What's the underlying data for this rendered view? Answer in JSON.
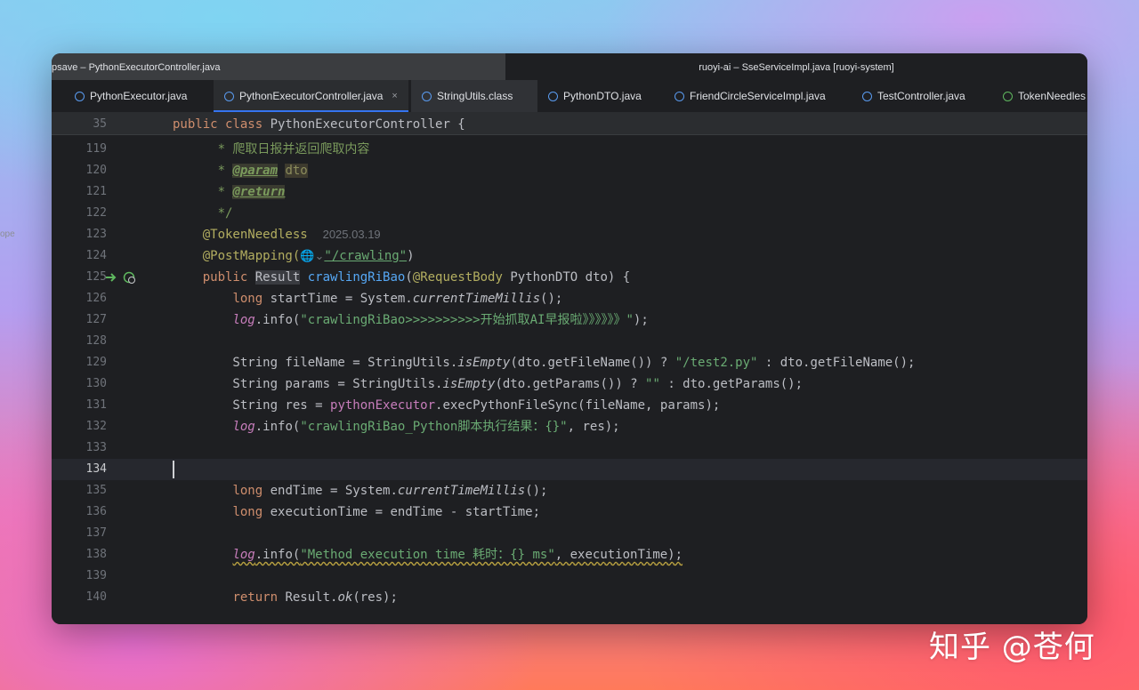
{
  "window": {
    "title_left": "psave – PythonExecutorController.java",
    "title_right": "ruoyi-ai – SseServiceImpl.java [ruoyi-system]"
  },
  "tabs": [
    {
      "label": "PythonExecutor.java",
      "icon": "class-icon",
      "active": false
    },
    {
      "label": "PythonExecutorController.java",
      "icon": "class-icon",
      "active": true,
      "close": "×"
    },
    {
      "label": "StringUtils.class",
      "icon": "class-icon",
      "active": false
    },
    {
      "label": "PythonDTO.java",
      "icon": "class-icon",
      "active": false
    },
    {
      "label": "FriendCircleServiceImpl.java",
      "icon": "class-icon",
      "active": false
    },
    {
      "label": "TestController.java",
      "icon": "class-icon",
      "active": false
    },
    {
      "label": "TokenNeedles",
      "icon": "annotation-icon",
      "active": false
    }
  ],
  "sticky": {
    "line_no": "35",
    "text": "public class PythonExecutorController {"
  },
  "lines": [
    {
      "no": "119",
      "text": "* 爬取日报并返回爬取内容"
    },
    {
      "no": "120",
      "tag": "@param",
      "param": "dto"
    },
    {
      "no": "121",
      "tag": "@return"
    },
    {
      "no": "122",
      "text": "*/"
    },
    {
      "no": "123",
      "ann": "@TokenNeedless",
      "hint": "2025.03.19"
    },
    {
      "no": "124",
      "ann": "@PostMapping(",
      "str": "\"/crawling\"",
      "end": ")"
    },
    {
      "no": "125",
      "text": "public Result crawlingRiBao(@RequestBody PythonDTO dto) {"
    },
    {
      "no": "126",
      "text": "long startTime = System.currentTimeMillis();"
    },
    {
      "no": "127",
      "str": "\"crawlingRiBao>>>>>>>>>>开始抓取AI早报啦》》》》》》\""
    },
    {
      "no": "128",
      "text": ""
    },
    {
      "no": "129",
      "str1": "\"/test2.py\""
    },
    {
      "no": "130",
      "str1": "\"\""
    },
    {
      "no": "131",
      "text": "String res = pythonExecutor.execPythonFileSync(fileName, params);"
    },
    {
      "no": "132",
      "str": "\"crawlingRiBao_Python脚本执行结果：{}\""
    },
    {
      "no": "133",
      "text": ""
    },
    {
      "no": "134",
      "text": ""
    },
    {
      "no": "135",
      "text": "long endTime = System.currentTimeMillis();"
    },
    {
      "no": "136",
      "text": "long executionTime = endTime - startTime;"
    },
    {
      "no": "137",
      "text": ""
    },
    {
      "no": "138",
      "str": "\"Method execution time 耗时：{} ms\""
    },
    {
      "no": "139",
      "text": ""
    },
    {
      "no": "140",
      "text": "return Result.ok(res);"
    }
  ],
  "side_marker": "ope",
  "watermark": "知乎 @苍何"
}
